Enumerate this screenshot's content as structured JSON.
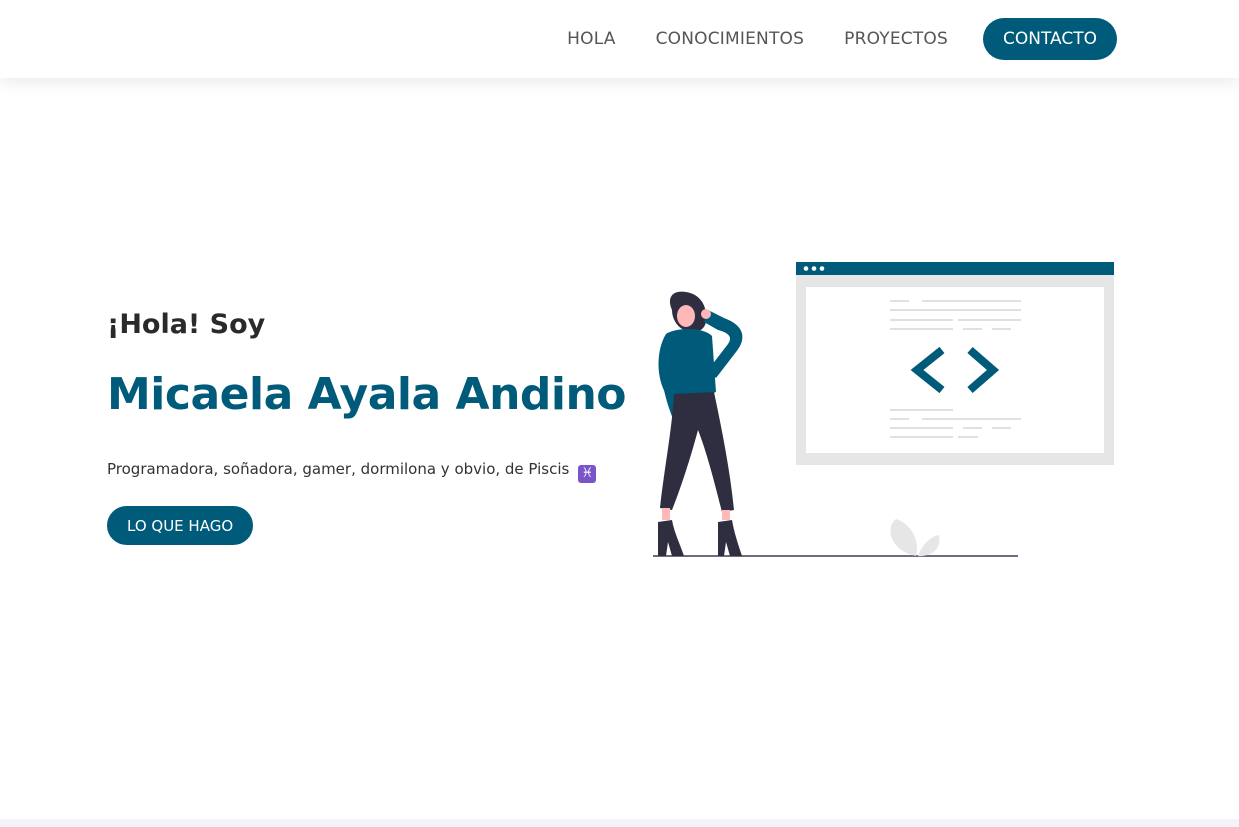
{
  "nav": {
    "links": [
      "HOLA",
      "CONOCIMIENTOS",
      "PROYECTOS"
    ],
    "cta_label": "CONTACTO"
  },
  "hero": {
    "greeting": "¡Hola! Soy",
    "name": "Micaela Ayala Andino",
    "tagline": "Programadora, soñadora, gamer, dormilona y obvio, de Piscis",
    "tagline_emoji": "♓",
    "button_label": "LO QUE HAGO"
  },
  "illustration": {
    "icon": "developer-code-window-illustration",
    "window_symbol": "< >"
  },
  "colors": {
    "accent": "#005a7a",
    "text_dark": "#2a2a2a",
    "nav_text": "#555555",
    "pants": "#2f2e41",
    "skin": "#ffb8b8",
    "window_gray": "#e6e6e6"
  }
}
